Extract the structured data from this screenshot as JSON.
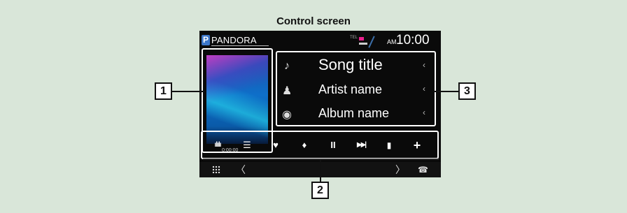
{
  "caption": "Control screen",
  "source": {
    "badge": "P",
    "name": "PANDORA"
  },
  "status": {
    "tel": "TEL",
    "ampm": "AM",
    "clock": "10:00"
  },
  "album": {
    "elapsed": "0:00:00"
  },
  "info": {
    "rows": [
      {
        "icon": "♪",
        "text": "Song title",
        "arrow": "‹"
      },
      {
        "icon": "♟",
        "text": "Artist name",
        "arrow": "‹"
      },
      {
        "icon": "◉",
        "text": "Album name",
        "arrow": "‹"
      }
    ]
  },
  "controls": {
    "buttons": [
      {
        "name": "equalizer",
        "glyph": "ılılı"
      },
      {
        "name": "list",
        "glyph": "☰"
      },
      {
        "name": "thumbs-down",
        "glyph": "♥"
      },
      {
        "name": "thumbs-up",
        "glyph": "♦"
      },
      {
        "name": "pause",
        "glyph": "II"
      },
      {
        "name": "skip",
        "glyph": "▶▶|"
      },
      {
        "name": "bookmark",
        "glyph": "▮"
      },
      {
        "name": "add",
        "glyph": "+"
      }
    ]
  },
  "bottom": {
    "left_arrow": "〈",
    "right_arrow": "〉",
    "phone": "☎"
  },
  "callouts": {
    "one": "1",
    "two": "2",
    "three": "3"
  },
  "colors": {
    "page_bg": "#d9e6d9",
    "screen_bg": "#0a0a0a",
    "badge": "#3d77c9",
    "accent_pink": "#e91e8c"
  }
}
